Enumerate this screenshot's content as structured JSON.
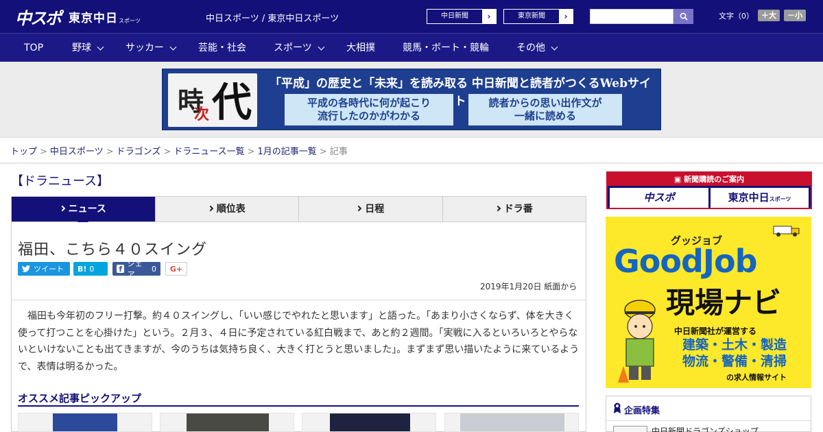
{
  "header": {
    "logo_main": "中スポ",
    "logo_tokyo": "東京中日",
    "logo_sub": "スポーツ",
    "site_names": "中日スポーツ / 東京中日スポーツ",
    "link_chunichi": "中日新聞",
    "link_tokyo": "東京新聞",
    "search_placeholder": "",
    "font_label": "文字（0）",
    "font_plus": "＋大",
    "font_minus": "－小"
  },
  "nav": {
    "items": [
      {
        "label": "TOP",
        "has_menu": false
      },
      {
        "label": "野球",
        "has_menu": true
      },
      {
        "label": "サッカー",
        "has_menu": true
      },
      {
        "label": "芸能・社会",
        "has_menu": false
      },
      {
        "label": "スポーツ",
        "has_menu": true
      },
      {
        "label": "大相撲",
        "has_menu": false
      },
      {
        "label": "競馬・ボート・競輪",
        "has_menu": false
      },
      {
        "label": "その他",
        "has_menu": true
      }
    ]
  },
  "banner": {
    "kanji1": "時",
    "kanji2": "次",
    "kanji3": "代",
    "headline": "「平成」の歴史と「未来」を読み取る 中日新聞と読者がつくるWebサイト",
    "box1_line1": "平成の各時代に何が起こり",
    "box1_line2": "流行したのかがわかる",
    "box2_line1": "読者からの思い出作文が",
    "box2_line2": "一緒に読める"
  },
  "breadcrumb": {
    "items": [
      "トップ",
      "中日スポーツ",
      "ドラゴンズ",
      "ドラニュース一覧",
      "1月の記事一覧"
    ],
    "current": "記事",
    "separator": ">"
  },
  "section": {
    "title": "【ドラニュース】"
  },
  "tabs": [
    {
      "label": "ニュース",
      "active": true
    },
    {
      "label": "順位表",
      "active": false
    },
    {
      "label": "日程",
      "active": false
    },
    {
      "label": "ドラ番",
      "active": false
    }
  ],
  "article": {
    "title": "福田、こちら４０スイング",
    "date": "2019年1月20日 紙面から",
    "body": "福田も今年初のフリー打撃。約４０スイングし、「いい感じでやれたと思います」と語った。「あまり小さくならず、体を大きく使って打つことを心掛けた」という。２月３、４日に予定されている紅白戦まで、あと約２週間。「実戦に入るといろいろとやらないといけないことも出てきますが、今のうちは気持ち良く、大きく打とうと思いました」。まずまず思い描いたように来ているようで、表情は明るかった。",
    "share": {
      "tweet": "ツイート",
      "hatena": "B!",
      "hatena_count": "0",
      "facebook": "シェア",
      "facebook_count": "0",
      "gplus": "G+"
    }
  },
  "pickup": {
    "title": "オススメ記事ピックアップ"
  },
  "sidebar": {
    "subscribe_head": "新聞購読のご案内",
    "paper1": "中スポ",
    "paper2": "東京中日",
    "paper2_sub": "スポーツ",
    "ad": {
      "small": "グッジョブ",
      "brand": "GoodJob",
      "title": "現場ナビ",
      "operator": "中日新聞社が運営する",
      "jobs1": "建築・土木・製造",
      "jobs2": "物流・警備・清掃",
      "site": "の求人情報サイト"
    },
    "feature_title": "企画特集",
    "feature_item": "中日新聞ドラゴンズショップ"
  },
  "colors": {
    "header_bg": "#13107a",
    "nav_bg": "#1c1986",
    "twitter": "#1b95e0",
    "hatena": "#00a4de",
    "facebook": "#3b5998",
    "accent_red": "#c8102e",
    "ad_yellow": "#fde82a"
  }
}
